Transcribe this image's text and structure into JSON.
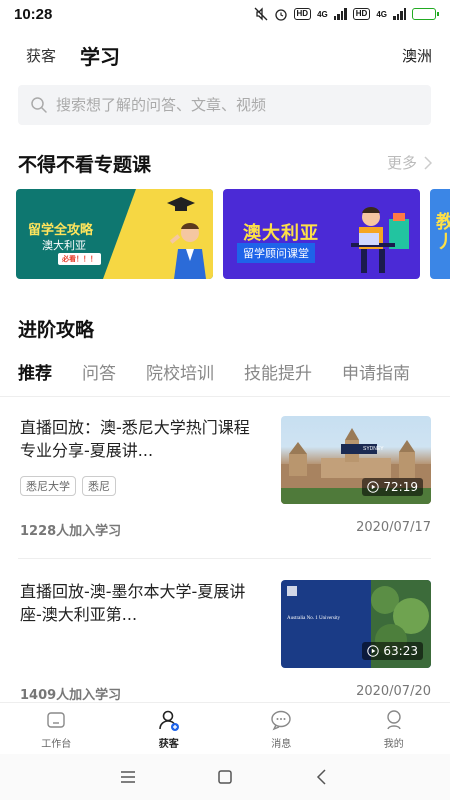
{
  "status_bar": {
    "time": "10:28",
    "network_1": "4G",
    "network_2": "4G",
    "hd_1": "HD",
    "hd_2": "HD"
  },
  "header": {
    "guest_tab": "获客",
    "title": "学习",
    "region": "澳洲"
  },
  "search": {
    "placeholder": "搜索想了解的问答、文章、视频"
  },
  "featured": {
    "title": "不得不看专题课",
    "more_label": "更多",
    "cards": [
      {
        "title": "留学全攻略",
        "subtitle": "澳大利亚",
        "badge": "必看！！！"
      },
      {
        "title": "澳大利亚",
        "subtitle": "留学顾问课堂"
      },
      {
        "title": "教",
        "subtitle": "丿"
      }
    ]
  },
  "advanced": {
    "title": "进阶攻略",
    "tabs": [
      {
        "label": "推荐",
        "active": true
      },
      {
        "label": "问答",
        "active": false
      },
      {
        "label": "院校培训",
        "active": false
      },
      {
        "label": "技能提升",
        "active": false
      },
      {
        "label": "申请指南",
        "active": false
      }
    ],
    "courses": [
      {
        "title": "直播回放：澳-悉尼大学热门课程专业分享-夏展讲...",
        "tags": [
          "悉尼大学",
          "悉尼"
        ],
        "duration": "72:19",
        "count": "1228人加入学习",
        "date": "2020/07/17",
        "thumb_logo": "SYDNEY"
      },
      {
        "title": "直播回放-澳-墨尔本大学-夏展讲座-澳大利亚第...",
        "tags": [],
        "duration": "63:23",
        "count": "1409人加入学习",
        "date": "2020/07/20",
        "thumb_heading": "Australia No. 1 University"
      }
    ]
  },
  "bottom_nav": {
    "items": [
      {
        "label": "工作台",
        "icon": "workbench-icon",
        "active": false
      },
      {
        "label": "获客",
        "icon": "user-add-icon",
        "active": true
      },
      {
        "label": "消息",
        "icon": "message-icon",
        "active": false
      },
      {
        "label": "我的",
        "icon": "profile-icon",
        "active": false
      }
    ]
  },
  "colors": {
    "accent": "#1e63e9",
    "card1_bg": "#0e7770",
    "card2_bg": "#4b2ad6",
    "card3_bg": "#3b86e6",
    "highlight_yellow": "#fde047"
  }
}
